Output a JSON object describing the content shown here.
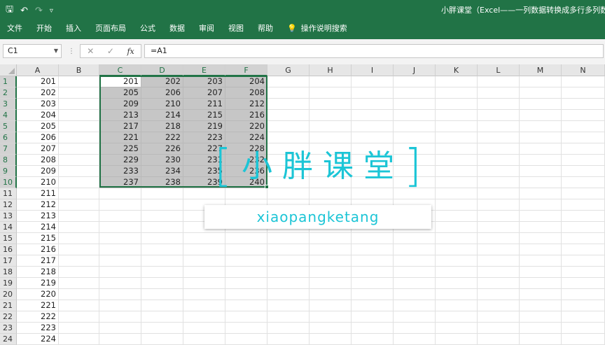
{
  "ribbon": {
    "title": "小胖课堂（Excel——一列数据转换成多行多列数",
    "tabs": [
      "文件",
      "开始",
      "插入",
      "页面布局",
      "公式",
      "数据",
      "审阅",
      "视图",
      "帮助"
    ],
    "tell_me": "操作说明搜索",
    "colors": {
      "bg": "#217346",
      "text": "#ffffff"
    }
  },
  "formula_bar": {
    "name_box": "C1",
    "cancel_icon": "✕",
    "enter_icon": "✓",
    "fx_label": "fx",
    "formula": "=A1"
  },
  "sheet": {
    "columns": [
      "A",
      "B",
      "C",
      "D",
      "E",
      "F",
      "G",
      "H",
      "I",
      "J",
      "K",
      "L",
      "M",
      "N"
    ],
    "rows": [
      "1",
      "2",
      "3",
      "4",
      "5",
      "6",
      "7",
      "8",
      "9",
      "10",
      "11",
      "12",
      "13",
      "14",
      "15",
      "16",
      "17",
      "18",
      "19",
      "20",
      "21",
      "22",
      "23",
      "24"
    ],
    "col_a_values": [
      "201",
      "202",
      "203",
      "204",
      "205",
      "206",
      "207",
      "208",
      "209",
      "210",
      "211",
      "212",
      "213",
      "214",
      "215",
      "216",
      "217",
      "218",
      "219",
      "220",
      "221",
      "222",
      "223",
      "224"
    ],
    "block_values": [
      [
        "201",
        "202",
        "203",
        "204"
      ],
      [
        "205",
        "206",
        "207",
        "208"
      ],
      [
        "209",
        "210",
        "211",
        "212"
      ],
      [
        "213",
        "214",
        "215",
        "216"
      ],
      [
        "217",
        "218",
        "219",
        "220"
      ],
      [
        "221",
        "222",
        "223",
        "224"
      ],
      [
        "225",
        "226",
        "227",
        "228"
      ],
      [
        "229",
        "230",
        "231",
        "232"
      ],
      [
        "233",
        "234",
        "235",
        "236"
      ],
      [
        "237",
        "238",
        "239",
        "240"
      ]
    ],
    "selection_color": "#217346"
  },
  "watermark": {
    "left_bracket": "[",
    "text": "小胖课堂",
    "right_bracket": "]",
    "subtitle": "xiaopangketang",
    "color": "#1cc5d6"
  }
}
